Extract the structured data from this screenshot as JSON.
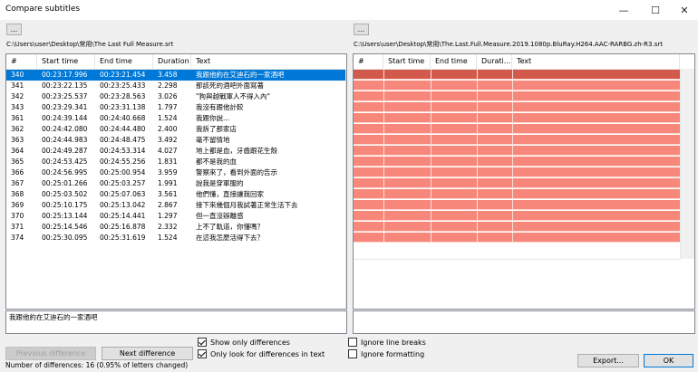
{
  "window": {
    "title": "Compare subtitles",
    "minimize_glyph": "—",
    "maximize_glyph": "☐",
    "close_glyph": "✕"
  },
  "left": {
    "browse_label": "...",
    "path": "C:\\Users\\user\\Desktop\\常用\\The Last Full Measure.srt",
    "columns": [
      "#",
      "Start time",
      "End time",
      "Duration",
      "Text"
    ],
    "rows": [
      [
        "340",
        "00:23:17.996",
        "00:23:21.454",
        "3.458",
        "我跟他約在艾迪石的一家酒吧"
      ],
      [
        "341",
        "00:23:22.135",
        "00:23:25.433",
        "2.298",
        "那該死的酒吧外面寫著"
      ],
      [
        "342",
        "00:23:25.537",
        "00:23:28.563",
        "3.026",
        "\"狗與越戰軍人不得入內\""
      ],
      [
        "343",
        "00:23:29.341",
        "00:23:31.138",
        "1.797",
        "我沒有跟他計較"
      ],
      [
        "361",
        "00:24:39.144",
        "00:24:40.668",
        "1.524",
        "我跟你說..."
      ],
      [
        "362",
        "00:24:42.080",
        "00:24:44.480",
        "2.400",
        "我拆了那家店"
      ],
      [
        "363",
        "00:24:44.983",
        "00:24:48.475",
        "3.492",
        "毫不留情地"
      ],
      [
        "364",
        "00:24:49.287",
        "00:24:53.314",
        "4.027",
        "地上都是血，牙齒跟花生殼"
      ],
      [
        "365",
        "00:24:53.425",
        "00:24:55.256",
        "1.831",
        "都不是我的血"
      ],
      [
        "366",
        "00:24:56.995",
        "00:25:00.954",
        "3.959",
        "警察來了，看到外面的告示"
      ],
      [
        "367",
        "00:25:01.266",
        "00:25:03.257",
        "1.991",
        "說我是穿軍服的"
      ],
      [
        "368",
        "00:25:03.502",
        "00:25:07.063",
        "3.561",
        "他們懂，直接讓我回家"
      ],
      [
        "369",
        "00:25:10.175",
        "00:25:13.042",
        "2.867",
        "接下來幾個月我試著正常生活下去"
      ],
      [
        "370",
        "00:25:13.144",
        "00:25:14.441",
        "1.297",
        "但一直沒辦離感"
      ],
      [
        "371",
        "00:25:14.546",
        "00:25:16.878",
        "2.332",
        "上不了軌道，你懂嗎？"
      ],
      [
        "374",
        "00:25:30.095",
        "00:25:31.619",
        "1.524",
        "在這我怎麼活得下去？"
      ]
    ],
    "preview_text": "我跟他約在艾迪石的一家酒吧"
  },
  "right": {
    "browse_label": "...",
    "path": "C:\\Users\\user\\Desktop\\常用\\The.Last.Full.Measure.2019.1080p.BluRay.H264.AAC-RARBG.zh-R3.srt",
    "columns": [
      "#",
      "Start time",
      "End time",
      "Durati...",
      "Text"
    ],
    "row_count": 16
  },
  "colors": {
    "selected_row": "#0078d7",
    "diff_row": "#f7877a",
    "diff_row_first": "#d25a4d"
  },
  "controls": {
    "previous_difference": "Previous difference",
    "next_difference": "Next difference",
    "show_only_differences": "Show only differences",
    "only_look_text": "Only look for differences in text",
    "ignore_line_breaks": "Ignore line breaks",
    "ignore_formatting": "Ignore formatting",
    "export": "Export...",
    "ok": "OK"
  },
  "status": {
    "text": "Number of differences: 16 (0.95% of letters changed)"
  }
}
